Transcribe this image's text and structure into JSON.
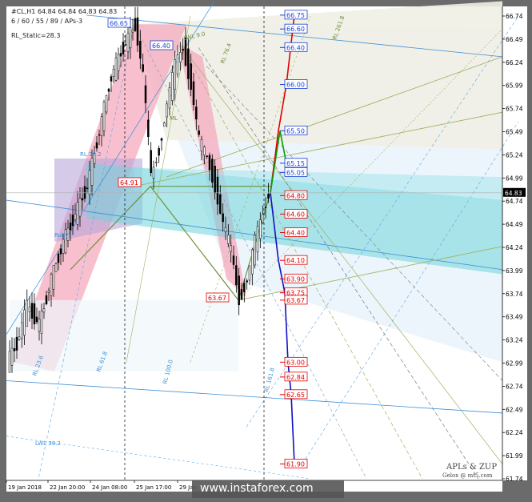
{
  "header": {
    "symbol_line": "#CL,H1  64.84 64.84 64.83 64.83",
    "indicator_line": "6 / 60 / 55 / 89 / APs-3",
    "rl_static": "RL_Static=28.3"
  },
  "credits": {
    "line1": "APLs & ZUP",
    "line2": "Gelox @ mt5.com"
  },
  "watermark": "www.instaforex.com",
  "colors": {
    "price_tag_bg": "#000000",
    "pink_channel": "#f5a9bf",
    "cyan_zone": "#6fd3d8",
    "forecast_red": "#e00000",
    "forecast_blue": "#1010c0",
    "forecast_green": "#00a000"
  },
  "chart_data": {
    "type": "candlestick",
    "y_axis": {
      "ylim": [
        61.74,
        66.74
      ],
      "ticks": [
        "66.74",
        "66.49",
        "66.24",
        "65.99",
        "65.74",
        "65.49",
        "65.24",
        "64.99",
        "64.74",
        "64.49",
        "64.24",
        "63.99",
        "63.74",
        "63.49",
        "63.24",
        "62.99",
        "62.74",
        "62.49",
        "62.24",
        "61.99",
        "61.74"
      ],
      "current_price": "64.83"
    },
    "x_axis": {
      "ticks": [
        "19 Jan 2018",
        "22 Jan 20:00",
        "24 Jan 08:00",
        "25 Jan 17:00",
        "29 Jan"
      ]
    },
    "pivots": [
      {
        "label": "66.65",
        "value": 66.65,
        "style": "blue"
      },
      {
        "label": "66.40",
        "value": 66.4,
        "style": "blue"
      },
      {
        "label": "64.91",
        "value": 64.91,
        "style": "red"
      },
      {
        "label": "63.67",
        "value": 63.67,
        "style": "red"
      }
    ],
    "forecast_levels": [
      {
        "label": "66.75",
        "value": 66.75,
        "style": "blue"
      },
      {
        "label": "66.60",
        "value": 66.6,
        "style": "blue"
      },
      {
        "label": "66.40",
        "value": 66.4,
        "style": "blue"
      },
      {
        "label": "66.00",
        "value": 66.0,
        "style": "blue"
      },
      {
        "label": "65.50",
        "value": 65.5,
        "style": "blue"
      },
      {
        "label": "65.15",
        "value": 65.15,
        "style": "blue"
      },
      {
        "label": "65.05",
        "value": 65.05,
        "style": "blue"
      },
      {
        "label": "64.80",
        "value": 64.8,
        "style": "red"
      },
      {
        "label": "64.60",
        "value": 64.6,
        "style": "red"
      },
      {
        "label": "64.40",
        "value": 64.4,
        "style": "red"
      },
      {
        "label": "64.10",
        "value": 64.1,
        "style": "red"
      },
      {
        "label": "63.90",
        "value": 63.9,
        "style": "red"
      },
      {
        "label": "63.75",
        "value": 63.75,
        "style": "red"
      },
      {
        "label": "63.67",
        "value": 63.67,
        "style": "red"
      },
      {
        "label": "63.00",
        "value": 63.0,
        "style": "red"
      },
      {
        "label": "62.84",
        "value": 62.84,
        "style": "red"
      },
      {
        "label": "62.65",
        "value": 62.65,
        "style": "red"
      },
      {
        "label": "61.90",
        "value": 61.9,
        "style": "red"
      }
    ],
    "line_labels": [
      "LWL 9.0",
      "ML",
      "RL 38.2",
      "RL 61.8",
      "RL 76.4",
      "RL 100.0",
      "RL 161.8",
      "RL 23.6",
      "RL 261.8",
      "LWL 38.2",
      "Ruby"
    ],
    "price_path": [
      [
        0,
        63.0
      ],
      [
        12,
        63.2
      ],
      [
        25,
        63.6
      ],
      [
        40,
        63.4
      ],
      [
        55,
        63.9
      ],
      [
        70,
        64.3
      ],
      [
        85,
        64.6
      ],
      [
        100,
        64.9
      ],
      [
        115,
        65.5
      ],
      [
        130,
        66.1
      ],
      [
        145,
        66.4
      ],
      [
        160,
        66.65
      ],
      [
        170,
        66.1
      ],
      [
        180,
        65.0
      ],
      [
        190,
        65.3
      ],
      [
        200,
        65.8
      ],
      [
        210,
        66.2
      ],
      [
        220,
        66.4
      ],
      [
        230,
        66.0
      ],
      [
        240,
        65.4
      ],
      [
        250,
        65.2
      ],
      [
        260,
        64.9
      ],
      [
        270,
        64.5
      ],
      [
        280,
        64.2
      ],
      [
        290,
        63.67
      ],
      [
        300,
        63.9
      ],
      [
        310,
        64.3
      ],
      [
        320,
        64.6
      ],
      [
        327,
        64.83
      ]
    ],
    "forecast_paths": [
      {
        "name": "",
        "color": "red",
        "points": [
          [
            330,
            64.83
          ],
          [
            340,
            65.5
          ],
          [
            350,
            66.0
          ],
          [
            360,
            66.75
          ]
        ]
      },
      {
        "name": "",
        "color": "green",
        "points": [
          [
            330,
            64.83
          ],
          [
            342,
            65.5
          ],
          [
            350,
            65.15
          ],
          [
            356,
            65.05
          ]
        ]
      },
      {
        "name": "",
        "color": "blue",
        "points": [
          [
            330,
            64.83
          ],
          [
            340,
            64.1
          ],
          [
            348,
            63.75
          ],
          [
            352,
            63.0
          ],
          [
            356,
            62.65
          ],
          [
            360,
            61.9
          ]
        ]
      }
    ]
  }
}
